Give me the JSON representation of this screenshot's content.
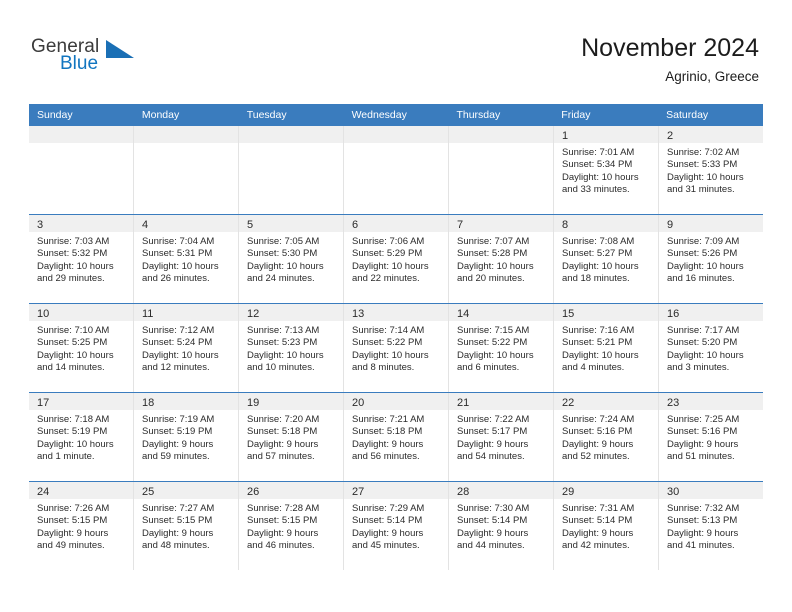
{
  "brand": {
    "word_one": "General",
    "word_two": "Blue",
    "triangle_icon": "brand-triangle-icon",
    "accent_color": "#1175c0"
  },
  "header": {
    "title": "November 2024",
    "subtitle": "Agrinio, Greece"
  },
  "theme": {
    "header_blue": "#3a7cbe",
    "daynum_band": "#f0f0f0",
    "cell_border": "#e3e3e3"
  },
  "weekdays": [
    "Sunday",
    "Monday",
    "Tuesday",
    "Wednesday",
    "Thursday",
    "Friday",
    "Saturday"
  ],
  "weeks": [
    [
      {
        "day": "",
        "lines": []
      },
      {
        "day": "",
        "lines": []
      },
      {
        "day": "",
        "lines": []
      },
      {
        "day": "",
        "lines": []
      },
      {
        "day": "",
        "lines": []
      },
      {
        "day": "1",
        "lines": [
          "Sunrise: 7:01 AM",
          "Sunset: 5:34 PM",
          "Daylight: 10 hours",
          "and 33 minutes."
        ]
      },
      {
        "day": "2",
        "lines": [
          "Sunrise: 7:02 AM",
          "Sunset: 5:33 PM",
          "Daylight: 10 hours",
          "and 31 minutes."
        ]
      }
    ],
    [
      {
        "day": "3",
        "lines": [
          "Sunrise: 7:03 AM",
          "Sunset: 5:32 PM",
          "Daylight: 10 hours",
          "and 29 minutes."
        ]
      },
      {
        "day": "4",
        "lines": [
          "Sunrise: 7:04 AM",
          "Sunset: 5:31 PM",
          "Daylight: 10 hours",
          "and 26 minutes."
        ]
      },
      {
        "day": "5",
        "lines": [
          "Sunrise: 7:05 AM",
          "Sunset: 5:30 PM",
          "Daylight: 10 hours",
          "and 24 minutes."
        ]
      },
      {
        "day": "6",
        "lines": [
          "Sunrise: 7:06 AM",
          "Sunset: 5:29 PM",
          "Daylight: 10 hours",
          "and 22 minutes."
        ]
      },
      {
        "day": "7",
        "lines": [
          "Sunrise: 7:07 AM",
          "Sunset: 5:28 PM",
          "Daylight: 10 hours",
          "and 20 minutes."
        ]
      },
      {
        "day": "8",
        "lines": [
          "Sunrise: 7:08 AM",
          "Sunset: 5:27 PM",
          "Daylight: 10 hours",
          "and 18 minutes."
        ]
      },
      {
        "day": "9",
        "lines": [
          "Sunrise: 7:09 AM",
          "Sunset: 5:26 PM",
          "Daylight: 10 hours",
          "and 16 minutes."
        ]
      }
    ],
    [
      {
        "day": "10",
        "lines": [
          "Sunrise: 7:10 AM",
          "Sunset: 5:25 PM",
          "Daylight: 10 hours",
          "and 14 minutes."
        ]
      },
      {
        "day": "11",
        "lines": [
          "Sunrise: 7:12 AM",
          "Sunset: 5:24 PM",
          "Daylight: 10 hours",
          "and 12 minutes."
        ]
      },
      {
        "day": "12",
        "lines": [
          "Sunrise: 7:13 AM",
          "Sunset: 5:23 PM",
          "Daylight: 10 hours",
          "and 10 minutes."
        ]
      },
      {
        "day": "13",
        "lines": [
          "Sunrise: 7:14 AM",
          "Sunset: 5:22 PM",
          "Daylight: 10 hours",
          "and 8 minutes."
        ]
      },
      {
        "day": "14",
        "lines": [
          "Sunrise: 7:15 AM",
          "Sunset: 5:22 PM",
          "Daylight: 10 hours",
          "and 6 minutes."
        ]
      },
      {
        "day": "15",
        "lines": [
          "Sunrise: 7:16 AM",
          "Sunset: 5:21 PM",
          "Daylight: 10 hours",
          "and 4 minutes."
        ]
      },
      {
        "day": "16",
        "lines": [
          "Sunrise: 7:17 AM",
          "Sunset: 5:20 PM",
          "Daylight: 10 hours",
          "and 3 minutes."
        ]
      }
    ],
    [
      {
        "day": "17",
        "lines": [
          "Sunrise: 7:18 AM",
          "Sunset: 5:19 PM",
          "Daylight: 10 hours",
          "and 1 minute."
        ]
      },
      {
        "day": "18",
        "lines": [
          "Sunrise: 7:19 AM",
          "Sunset: 5:19 PM",
          "Daylight: 9 hours",
          "and 59 minutes."
        ]
      },
      {
        "day": "19",
        "lines": [
          "Sunrise: 7:20 AM",
          "Sunset: 5:18 PM",
          "Daylight: 9 hours",
          "and 57 minutes."
        ]
      },
      {
        "day": "20",
        "lines": [
          "Sunrise: 7:21 AM",
          "Sunset: 5:18 PM",
          "Daylight: 9 hours",
          "and 56 minutes."
        ]
      },
      {
        "day": "21",
        "lines": [
          "Sunrise: 7:22 AM",
          "Sunset: 5:17 PM",
          "Daylight: 9 hours",
          "and 54 minutes."
        ]
      },
      {
        "day": "22",
        "lines": [
          "Sunrise: 7:24 AM",
          "Sunset: 5:16 PM",
          "Daylight: 9 hours",
          "and 52 minutes."
        ]
      },
      {
        "day": "23",
        "lines": [
          "Sunrise: 7:25 AM",
          "Sunset: 5:16 PM",
          "Daylight: 9 hours",
          "and 51 minutes."
        ]
      }
    ],
    [
      {
        "day": "24",
        "lines": [
          "Sunrise: 7:26 AM",
          "Sunset: 5:15 PM",
          "Daylight: 9 hours",
          "and 49 minutes."
        ]
      },
      {
        "day": "25",
        "lines": [
          "Sunrise: 7:27 AM",
          "Sunset: 5:15 PM",
          "Daylight: 9 hours",
          "and 48 minutes."
        ]
      },
      {
        "day": "26",
        "lines": [
          "Sunrise: 7:28 AM",
          "Sunset: 5:15 PM",
          "Daylight: 9 hours",
          "and 46 minutes."
        ]
      },
      {
        "day": "27",
        "lines": [
          "Sunrise: 7:29 AM",
          "Sunset: 5:14 PM",
          "Daylight: 9 hours",
          "and 45 minutes."
        ]
      },
      {
        "day": "28",
        "lines": [
          "Sunrise: 7:30 AM",
          "Sunset: 5:14 PM",
          "Daylight: 9 hours",
          "and 44 minutes."
        ]
      },
      {
        "day": "29",
        "lines": [
          "Sunrise: 7:31 AM",
          "Sunset: 5:14 PM",
          "Daylight: 9 hours",
          "and 42 minutes."
        ]
      },
      {
        "day": "30",
        "lines": [
          "Sunrise: 7:32 AM",
          "Sunset: 5:13 PM",
          "Daylight: 9 hours",
          "and 41 minutes."
        ]
      }
    ]
  ]
}
